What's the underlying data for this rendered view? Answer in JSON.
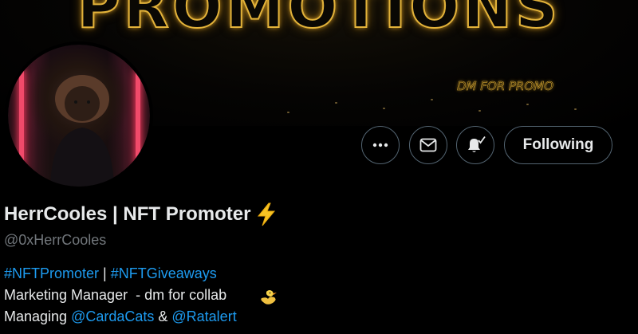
{
  "banner": {
    "title": "PROMOTIONS",
    "subtitle": "DM FOR PROMO",
    "accent_color": "#e2b23a"
  },
  "avatar": {
    "icon": "lion-in-hoodie-avatar"
  },
  "actions": {
    "more_icon": "more-dots-icon",
    "message_icon": "mail-icon",
    "notify_icon": "bell-check-icon",
    "follow_label": "Following"
  },
  "profile": {
    "display_name": "HerrCooles | NFT Promoter",
    "name_emoji": "lightning-bolt-icon",
    "handle": "@0xHerrCooles"
  },
  "bio": {
    "line1": {
      "tag1": "#NFTPromoter",
      "sep": " | ",
      "tag2": "#NFTGiveaways"
    },
    "line2": {
      "text": "Marketing Manager  - dm for collab",
      "emoji": "hatching-chick-icon"
    },
    "line3": {
      "prefix": "Managing ",
      "mention1": "@CardaCats",
      "amp": " & ",
      "mention2": "@Ratalert"
    }
  },
  "colors": {
    "link": "#1d9bf0",
    "text": "#e7e9ea",
    "secondary": "#71767b",
    "border": "#536471",
    "background": "#000000"
  }
}
